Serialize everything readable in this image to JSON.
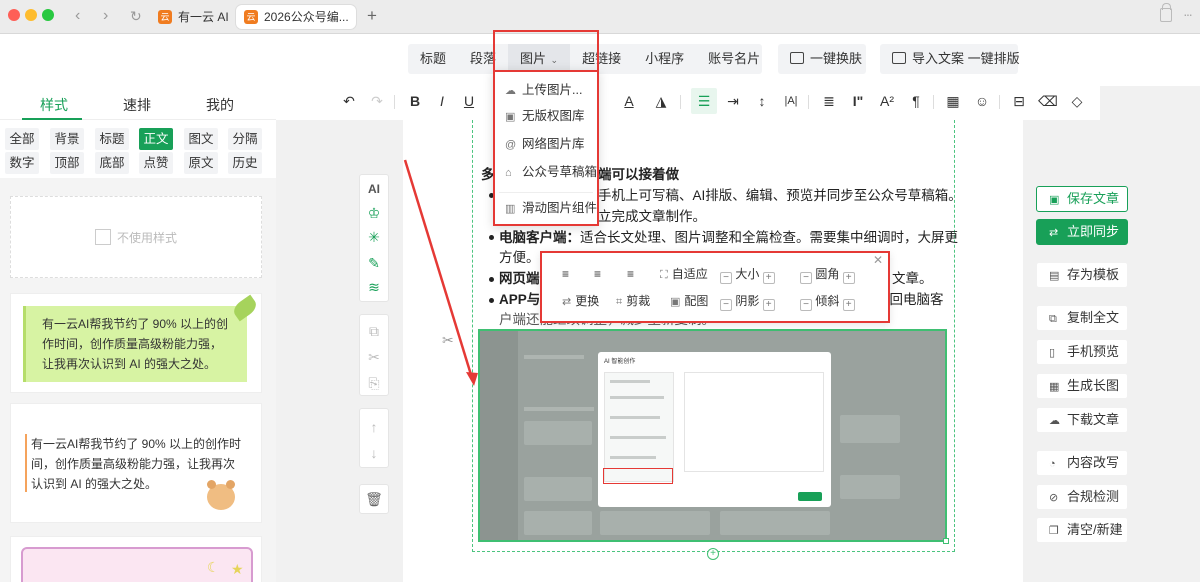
{
  "browser": {
    "tabs": [
      {
        "title": "有一云 AI"
      },
      {
        "title": "2026公众号编..."
      }
    ]
  },
  "insert_bar": {
    "group1": [
      "标题",
      "段落",
      "图片",
      "超链接",
      "小程序",
      "账号名片"
    ],
    "one_click_skin": "一键换肤",
    "import": "导入文案 一键排版"
  },
  "image_menu": {
    "items": [
      {
        "label": "上传图片...",
        "icon": "upload-cloud-icon"
      },
      {
        "label": "无版权图库",
        "icon": "gallery-icon"
      },
      {
        "label": "网络图片库",
        "icon": "at-icon"
      },
      {
        "label": "公众号草稿箱",
        "icon": "inbox-icon"
      },
      {
        "label": "滑动图片组件",
        "icon": "book-icon"
      }
    ]
  },
  "left_panel": {
    "tabs": [
      "样式",
      "速排",
      "我的"
    ],
    "categories": [
      "全部",
      "背景",
      "标题",
      "正文",
      "图文",
      "分隔",
      "数字",
      "顶部",
      "底部",
      "点赞",
      "原文",
      "历史"
    ],
    "active_category": "正文",
    "no_style": "不使用样式",
    "card_green_text": "有一云AI帮我节约了 90% 以上的创作时间，创作质量高级粉能力强，让我再次认识到 AI 的强大之处。",
    "card_bear_text": "有一云AI帮我节约了 90% 以上的创作时间，创作质量高级粉能力强，让我再次认识到 AI 的强大之处。"
  },
  "editor": {
    "heading_visible": "多",
    "heading_tail": "端可以接着做",
    "line1_tail": "手机上可写稿、AI排版、编辑、预览并同步至公众号草稿箱。",
    "line1b_tail": "立完成文章制作。",
    "b2_label": "电脑客户端：",
    "b2_text": "适合长文处理、图片调整和全篇检查。需要集中细调时，大屏更",
    "b2_cont": "方便。",
    "b3_label": "网页端",
    "b3_tail": "文章。",
    "b4_label": "APP与",
    "b4_tail": "，回电脑客",
    "b4_cont": "户端还能继续调整，减少重新复制。",
    "embed_dialog_title": "AI 智能创作"
  },
  "image_toolbar": {
    "row1": [
      "自适应",
      "大小",
      "圆角"
    ],
    "row2": [
      "更换",
      "剪裁",
      "配图",
      "阴影",
      "倾斜"
    ]
  },
  "right_panel": {
    "save": "保存文章",
    "sync": "立即同步",
    "actions": [
      "存为模板",
      "复制全文",
      "手机预览",
      "生成长图",
      "下载文章",
      "内容改写",
      "合规检测",
      "清空/新建"
    ]
  },
  "colors": {
    "accent": "#18a058",
    "highlight_red": "#e53935"
  }
}
